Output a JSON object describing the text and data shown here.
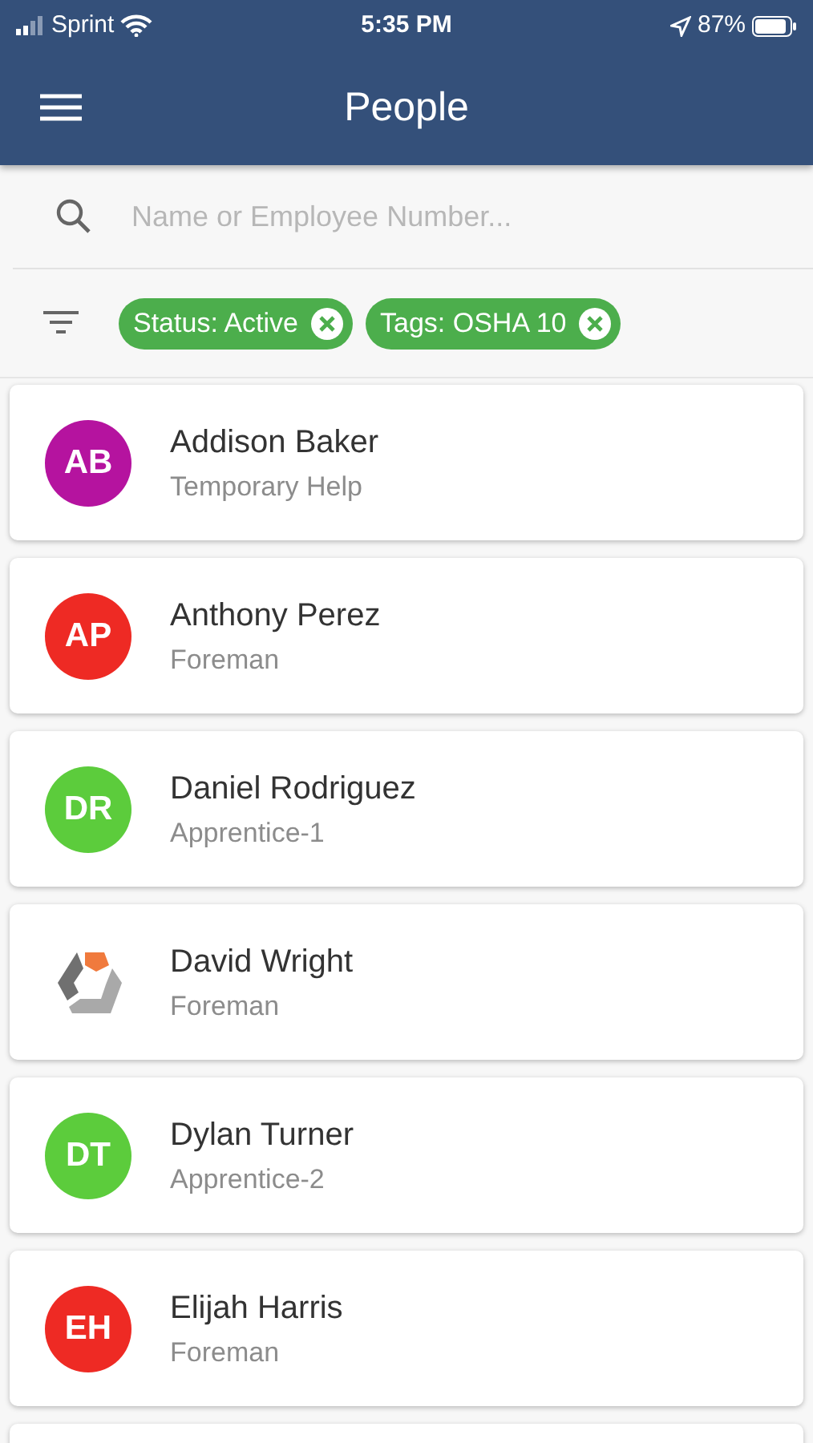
{
  "status_bar": {
    "carrier": "Sprint",
    "time": "5:35 PM",
    "battery": "87%"
  },
  "header": {
    "title": "People"
  },
  "search": {
    "placeholder": "Name or Employee Number..."
  },
  "filters": [
    {
      "label": "Status: Active"
    },
    {
      "label": "Tags: OSHA 10"
    }
  ],
  "people": [
    {
      "kind": "initials",
      "initials": "AB",
      "color": "#b5139f",
      "name": "Addison Baker",
      "role": "Temporary Help"
    },
    {
      "kind": "initials",
      "initials": "AP",
      "color": "#ee2a24",
      "name": "Anthony Perez",
      "role": "Foreman"
    },
    {
      "kind": "initials",
      "initials": "DR",
      "color": "#5ccc3c",
      "name": "Daniel Rodriguez",
      "role": "Apprentice-1"
    },
    {
      "kind": "logo",
      "name": "David Wright",
      "role": "Foreman"
    },
    {
      "kind": "initials",
      "initials": "DT",
      "color": "#5ccc3c",
      "name": "Dylan Turner",
      "role": "Apprentice-2"
    },
    {
      "kind": "initials",
      "initials": "EH",
      "color": "#ee2a24",
      "name": "Elijah Harris",
      "role": "Foreman"
    }
  ]
}
